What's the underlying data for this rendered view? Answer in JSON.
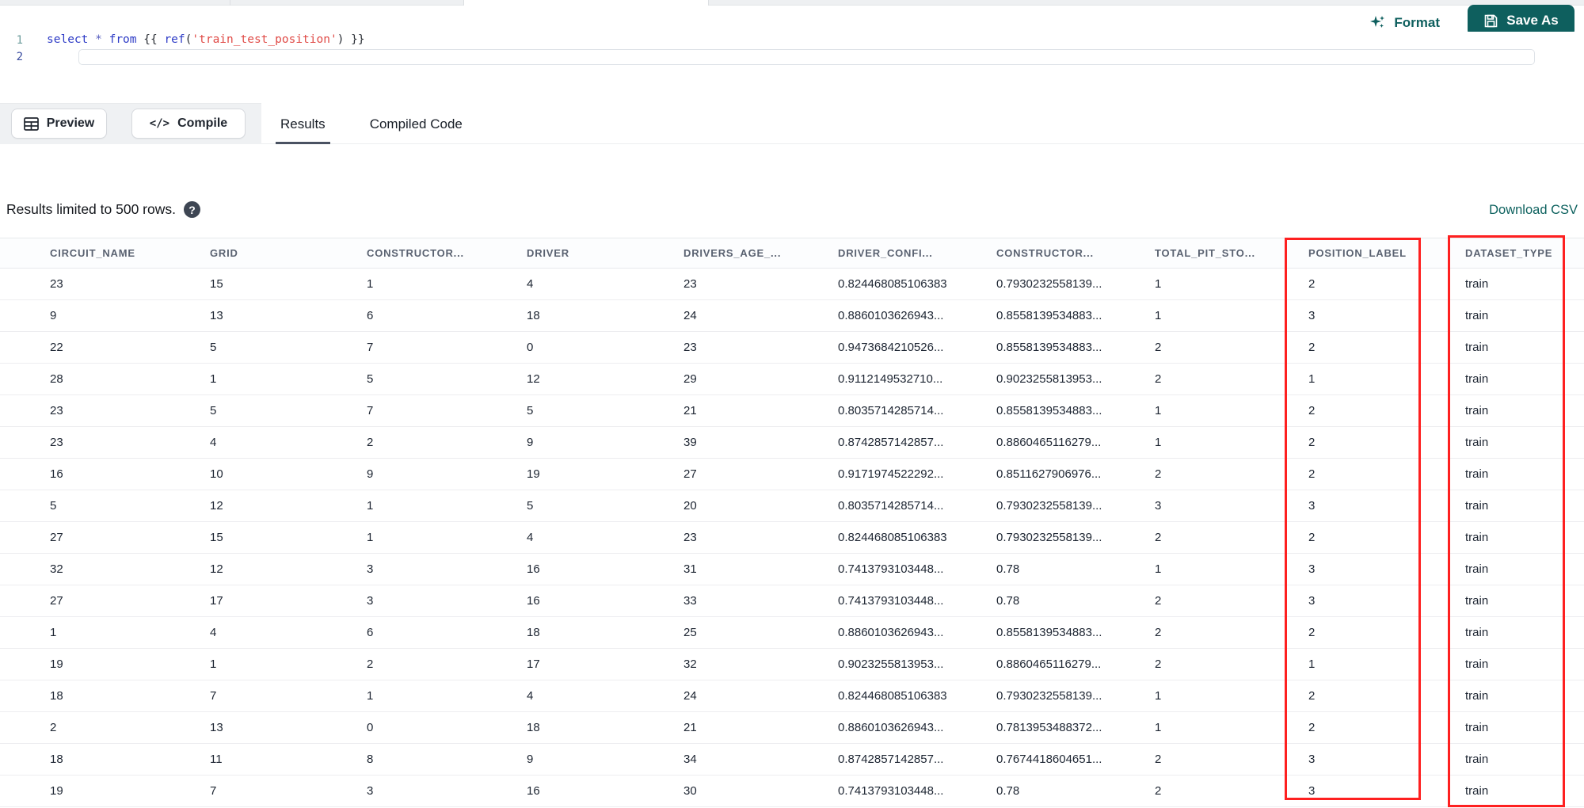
{
  "editor": {
    "lines": [
      {
        "number": "1",
        "tokens": [
          {
            "text": "select",
            "type": "kw"
          },
          {
            "text": " ",
            "type": "pl"
          },
          {
            "text": "*",
            "type": "op"
          },
          {
            "text": " ",
            "type": "pl"
          },
          {
            "text": "from",
            "type": "kw"
          },
          {
            "text": " {{ ",
            "type": "pl"
          },
          {
            "text": "ref",
            "type": "fn"
          },
          {
            "text": "(",
            "type": "pl"
          },
          {
            "text": "'train_test_position'",
            "type": "str"
          },
          {
            "text": ")",
            "type": "pl"
          },
          {
            "text": " }}",
            "type": "pl"
          }
        ]
      },
      {
        "number": "2",
        "tokens": []
      }
    ]
  },
  "toolbar": {
    "format_label": "Format",
    "save_as_label": "Save As"
  },
  "action_bar": {
    "preview_label": "Preview",
    "compile_label": "Compile",
    "compile_glyph": "</>"
  },
  "tabs": [
    {
      "label": "Results",
      "active": true
    },
    {
      "label": "Compiled Code",
      "active": false
    }
  ],
  "results": {
    "limit_note": "Results limited to 500 rows.",
    "help_glyph": "?",
    "download_label": "Download CSV",
    "highlighted_columns": [
      "POSITION_LABEL",
      "DATASET_TYPE"
    ],
    "table": {
      "columns": [
        "CIRCUIT_NAME",
        "GRID",
        "CONSTRUCTOR...",
        "DRIVER",
        "DRIVERS_AGE_...",
        "DRIVER_CONFI...",
        "CONSTRUCTOR...",
        "TOTAL_PIT_STO...",
        "POSITION_LABEL",
        "DATASET_TYPE"
      ],
      "rows": [
        [
          "23",
          "15",
          "1",
          "4",
          "23",
          "0.824468085106383",
          "0.7930232558139...",
          "1",
          "2",
          "train"
        ],
        [
          "9",
          "13",
          "6",
          "18",
          "24",
          "0.8860103626943...",
          "0.8558139534883...",
          "1",
          "3",
          "train"
        ],
        [
          "22",
          "5",
          "7",
          "0",
          "23",
          "0.9473684210526...",
          "0.8558139534883...",
          "2",
          "2",
          "train"
        ],
        [
          "28",
          "1",
          "5",
          "12",
          "29",
          "0.9112149532710...",
          "0.9023255813953...",
          "2",
          "1",
          "train"
        ],
        [
          "23",
          "5",
          "7",
          "5",
          "21",
          "0.8035714285714...",
          "0.8558139534883...",
          "1",
          "2",
          "train"
        ],
        [
          "23",
          "4",
          "2",
          "9",
          "39",
          "0.8742857142857...",
          "0.8860465116279...",
          "1",
          "2",
          "train"
        ],
        [
          "16",
          "10",
          "9",
          "19",
          "27",
          "0.9171974522292...",
          "0.8511627906976...",
          "2",
          "2",
          "train"
        ],
        [
          "5",
          "12",
          "1",
          "5",
          "20",
          "0.8035714285714...",
          "0.7930232558139...",
          "3",
          "3",
          "train"
        ],
        [
          "27",
          "15",
          "1",
          "4",
          "23",
          "0.824468085106383",
          "0.7930232558139...",
          "2",
          "2",
          "train"
        ],
        [
          "32",
          "12",
          "3",
          "16",
          "31",
          "0.7413793103448...",
          "0.78",
          "1",
          "3",
          "train"
        ],
        [
          "27",
          "17",
          "3",
          "16",
          "33",
          "0.7413793103448...",
          "0.78",
          "2",
          "3",
          "train"
        ],
        [
          "1",
          "4",
          "6",
          "18",
          "25",
          "0.8860103626943...",
          "0.8558139534883...",
          "2",
          "2",
          "train"
        ],
        [
          "19",
          "1",
          "2",
          "17",
          "32",
          "0.9023255813953...",
          "0.8860465116279...",
          "2",
          "1",
          "train"
        ],
        [
          "18",
          "7",
          "1",
          "4",
          "24",
          "0.824468085106383",
          "0.7930232558139...",
          "1",
          "2",
          "train"
        ],
        [
          "2",
          "13",
          "0",
          "18",
          "21",
          "0.8860103626943...",
          "0.7813953488372...",
          "1",
          "2",
          "train"
        ],
        [
          "18",
          "11",
          "8",
          "9",
          "34",
          "0.8742857142857...",
          "0.7674418604651...",
          "2",
          "3",
          "train"
        ],
        [
          "19",
          "7",
          "3",
          "16",
          "30",
          "0.7413793103448...",
          "0.78",
          "2",
          "3",
          "train"
        ]
      ]
    }
  },
  "colors": {
    "accent_teal": "#0e5f5e",
    "highlight_red": "#fe2020"
  },
  "icons": {
    "format": "sparkles-icon",
    "save_as": "floppy-disk-icon",
    "preview": "table-grid-icon",
    "compile": "code-icon",
    "help": "question-mark-icon"
  }
}
